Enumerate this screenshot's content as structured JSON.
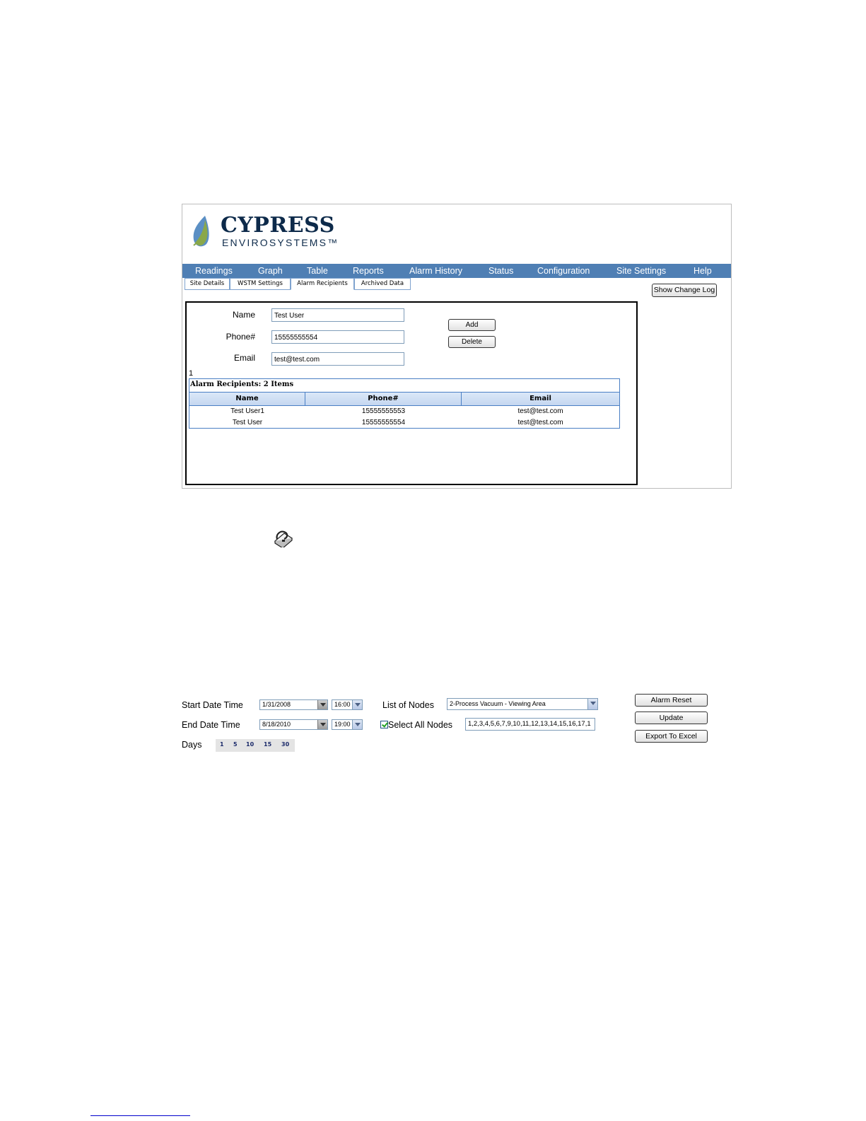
{
  "brand": {
    "name": "CYPRESS",
    "sub": "ENVIROSYSTEMS™",
    "leaf_color": "#8aa84a",
    "drop_color": "#5b8fc4"
  },
  "nav": {
    "items": [
      "Readings",
      "Graph",
      "Table",
      "Reports",
      "Alarm History",
      "Status",
      "Configuration",
      "Site Settings",
      "Help"
    ],
    "bg_color": "#4f7fb4"
  },
  "subtabs": {
    "items": [
      "Site Details",
      "WSTM Settings",
      "Alarm Recipients",
      "Archived Data"
    ],
    "active": "Alarm Recipients"
  },
  "change_log_button": "Show Change Log",
  "form": {
    "name_label": "Name",
    "name_value": "Test User",
    "phone_label": "Phone#",
    "phone_value": "15555555554",
    "email_label": "Email",
    "email_value": "test@test.com",
    "add_button": "Add",
    "delete_button": "Delete"
  },
  "pager": "1",
  "recipients_table": {
    "caption": "Alarm Recipients: 2 Items",
    "columns": [
      "Name",
      "Phone#",
      "Email"
    ],
    "rows": [
      {
        "name": "Test User1",
        "phone": "15555555553",
        "email": "test@test.com"
      },
      {
        "name": "Test User",
        "phone": "15555555554",
        "email": "test@test.com"
      }
    ]
  },
  "icons": {
    "help_book": "help-book-icon"
  },
  "readings_controls": {
    "start_label": "Start Date Time",
    "start_date": "1/31/2008",
    "start_time": "16:00",
    "end_label": "End Date Time",
    "end_date": "8/18/2010",
    "end_time": "19:00",
    "nodes_label": "List of Nodes",
    "nodes_selected": "2-Process Vacuum - Viewing Area",
    "select_all_label": "Select All Nodes",
    "select_all_checked": true,
    "nodes_list": "1,2,3,4,5,6,7,9,10,11,12,13,14,15,16,17,1",
    "days_label": "Days",
    "days_options": [
      "1",
      "5",
      "10",
      "15",
      "30"
    ],
    "alarm_reset_button": "Alarm Reset",
    "update_button": "Update",
    "export_button": "Export To Excel"
  }
}
